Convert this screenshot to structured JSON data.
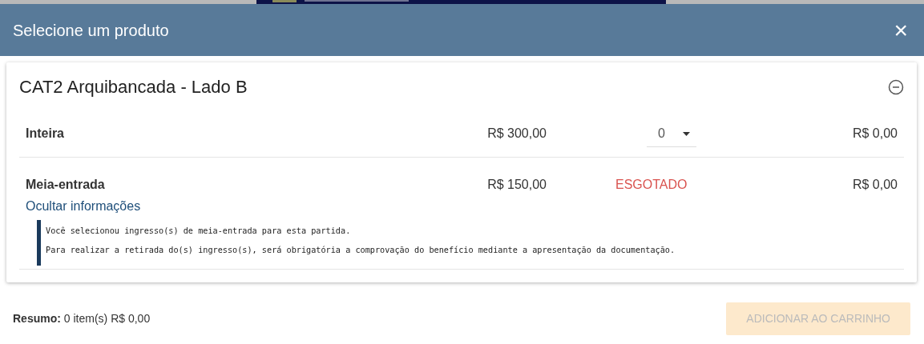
{
  "modal": {
    "title": "Selecione um produto",
    "close": "×"
  },
  "product": {
    "name": "CAT2 Arquibancada - Lado B",
    "expanded": true
  },
  "rows": [
    {
      "kind": "select",
      "name": "Inteira",
      "price": "R$ 300,00",
      "quantity": "0",
      "total": "R$ 0,00"
    },
    {
      "kind": "sold_out",
      "name": "Meia-entrada",
      "price": "R$ 150,00",
      "status": "ESGOTADO",
      "total": "R$ 0,00",
      "info_link": "Ocultar informações",
      "info": [
        "Você selecionou ingresso(s) de meia-entrada para esta partida.",
        "Para realizar a retirada do(s) ingresso(s), será obrigatória a comprovação do benefício mediante a apresentação da documentação."
      ]
    }
  ],
  "summary": "**Resumo:** 0 item(s) R$ 0,00",
  "add_button": {
    "label": "ADICIONAR AO CARRINHO",
    "disabled": true
  }
}
